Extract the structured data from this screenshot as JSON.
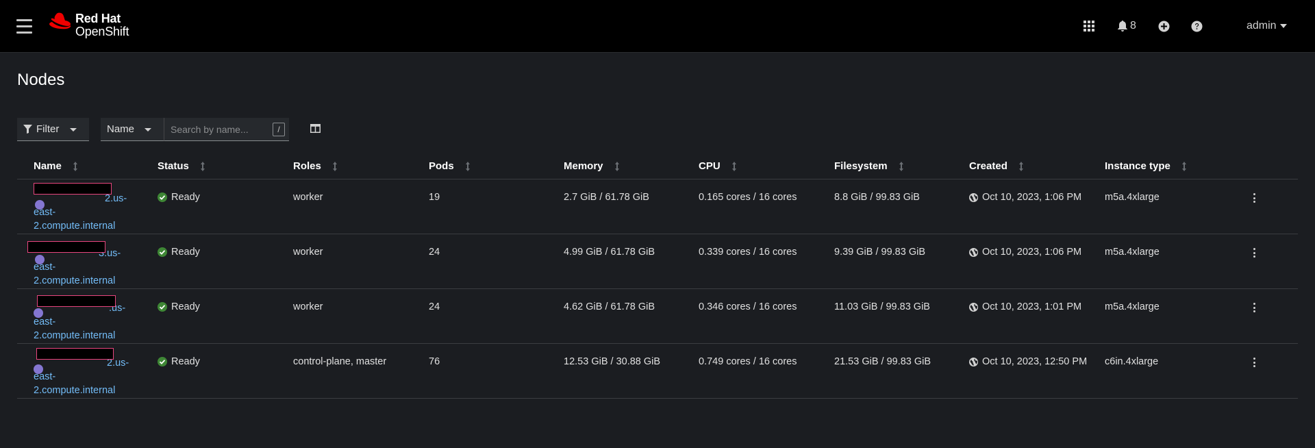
{
  "masthead": {
    "brand_line1": "Red Hat",
    "brand_line2": "OpenShift",
    "notifications_count": "8",
    "user": "admin"
  },
  "page": {
    "title": "Nodes"
  },
  "toolbar": {
    "filter_label": "Filter",
    "name_select_label": "Name",
    "search_placeholder": "Search by name...",
    "search_hint": "/"
  },
  "table": {
    "columns": [
      "Name",
      "Status",
      "Roles",
      "Pods",
      "Memory",
      "CPU",
      "Filesystem",
      "Created",
      "Instance type"
    ],
    "rows": [
      {
        "name_l1": "2.us-",
        "name_l2": "east-",
        "name_l3": "2.compute.internal",
        "status": "Ready",
        "roles": "worker",
        "pods": "19",
        "memory": "2.7 GiB / 61.78 GiB",
        "cpu": "0.165 cores / 16 cores",
        "filesystem": "8.8 GiB / 99.83 GiB",
        "created": "Oct 10, 2023, 1:06 PM",
        "instance_type": "m5a.4xlarge"
      },
      {
        "name_l1": "3.us-",
        "name_l2": "east-",
        "name_l3": "2.compute.internal",
        "status": "Ready",
        "roles": "worker",
        "pods": "24",
        "memory": "4.99 GiB / 61.78 GiB",
        "cpu": "0.339 cores / 16 cores",
        "filesystem": "9.39 GiB / 99.83 GiB",
        "created": "Oct 10, 2023, 1:06 PM",
        "instance_type": "m5a.4xlarge"
      },
      {
        "name_l1": ".us-",
        "name_l2": "east-",
        "name_l3": "2.compute.internal",
        "status": "Ready",
        "roles": "worker",
        "pods": "24",
        "memory": "4.62 GiB / 61.78 GiB",
        "cpu": "0.346 cores / 16 cores",
        "filesystem": "11.03 GiB / 99.83 GiB",
        "created": "Oct 10, 2023, 1:01 PM",
        "instance_type": "m5a.4xlarge"
      },
      {
        "name_l1": "2.us-",
        "name_l2": "east-",
        "name_l3": "2.compute.internal",
        "status": "Ready",
        "roles": "control-plane, master",
        "pods": "76",
        "memory": "12.53 GiB / 30.88 GiB",
        "cpu": "0.749 cores / 16 cores",
        "filesystem": "21.53 GiB / 99.83 GiB",
        "created": "Oct 10, 2023, 12:50 PM",
        "instance_type": "c6in.4xlarge"
      }
    ]
  },
  "colors": {
    "masthead_bg": "#000000",
    "page_bg": "#1b1d21",
    "link": "#73bcf7",
    "status_ok": "#3e8635",
    "brand_red": "#ee0000",
    "redaction_border": "#e8457e"
  }
}
